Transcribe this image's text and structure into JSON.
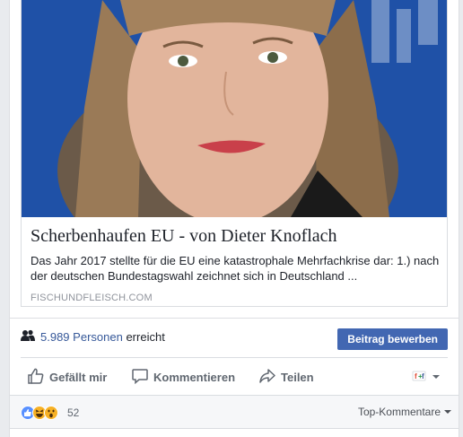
{
  "link_preview": {
    "title": "Scherbenhaufen EU - von Dieter Knoflach",
    "description": "Das Jahr 2017 stellte für die EU eine katastrophale Mehrfachkrise dar: 1.) nach der deutschen Bundestagswahl zeichnet sich in Deutschland ...",
    "domain": "FISCHUNDFLEISCH.COM"
  },
  "reach": {
    "count": "5.989",
    "persons_label": "Personen",
    "suffix": "erreicht"
  },
  "boost_button": {
    "label": "Beitrag bewerben"
  },
  "actions": {
    "like": "Gefällt mir",
    "comment": "Kommentieren",
    "share": "Teilen"
  },
  "reactions": {
    "count": "52",
    "types": [
      "like-reaction-icon",
      "haha-reaction-icon",
      "wow-reaction-icon"
    ]
  },
  "comments_sort": {
    "label": "Top-Kommentare"
  },
  "colors": {
    "link": "#365899",
    "button": "#4267b2",
    "muted": "#606770",
    "like_blue": "#5890ff",
    "reaction_yellow": "#f7b125"
  }
}
